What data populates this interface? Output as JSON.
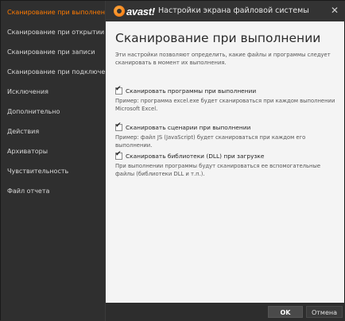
{
  "app": {
    "logo_text": "avast!",
    "window_title": "Настройки экрана файловой системы",
    "close_symbol": "✕"
  },
  "sidebar": {
    "items": [
      {
        "label": "Сканирование при выполнении",
        "active": true
      },
      {
        "label": "Сканирование при открытии",
        "active": false
      },
      {
        "label": "Сканирование при записи",
        "active": false
      },
      {
        "label": "Сканирование при подключении",
        "active": false
      },
      {
        "label": "Исключения",
        "active": false
      },
      {
        "label": "Дополнительно",
        "active": false
      },
      {
        "label": "Действия",
        "active": false
      },
      {
        "label": "Архиваторы",
        "active": false
      },
      {
        "label": "Чувствительность",
        "active": false
      },
      {
        "label": "Файл отчета",
        "active": false
      }
    ]
  },
  "main": {
    "title": "Сканирование при выполнении",
    "intro": "Эти настройки позволяют определить, какие файлы и программы следует сканировать в момент их выполнения.",
    "options": [
      {
        "label": "Сканировать программы при выполнении",
        "checked": true,
        "description": "Пример: программа excel.exe будет сканироваться при каждом выполнении Microsoft Excel."
      },
      {
        "label": "Сканировать сценарии при выполнении",
        "checked": true,
        "description": "Пример: файл JS (JavaScript) будет сканироваться при каждом его выполнении."
      },
      {
        "label": "Сканировать библиотеки (DLL) при загрузке",
        "checked": true,
        "description": "При выполнении программы будут сканироваться ее вспомогательные файлы (библиотеки DLL и т.п.)."
      }
    ]
  },
  "footer": {
    "ok_label": "OK",
    "cancel_label": "Отмена"
  },
  "colors": {
    "accent": "#ff7a00",
    "sidebar_bg": "#2f2f2f",
    "content_bg": "#f4f4f4"
  },
  "icons": {
    "logo": "avast-logo-icon",
    "close": "close-icon",
    "checkbox": "checkmark-icon"
  }
}
